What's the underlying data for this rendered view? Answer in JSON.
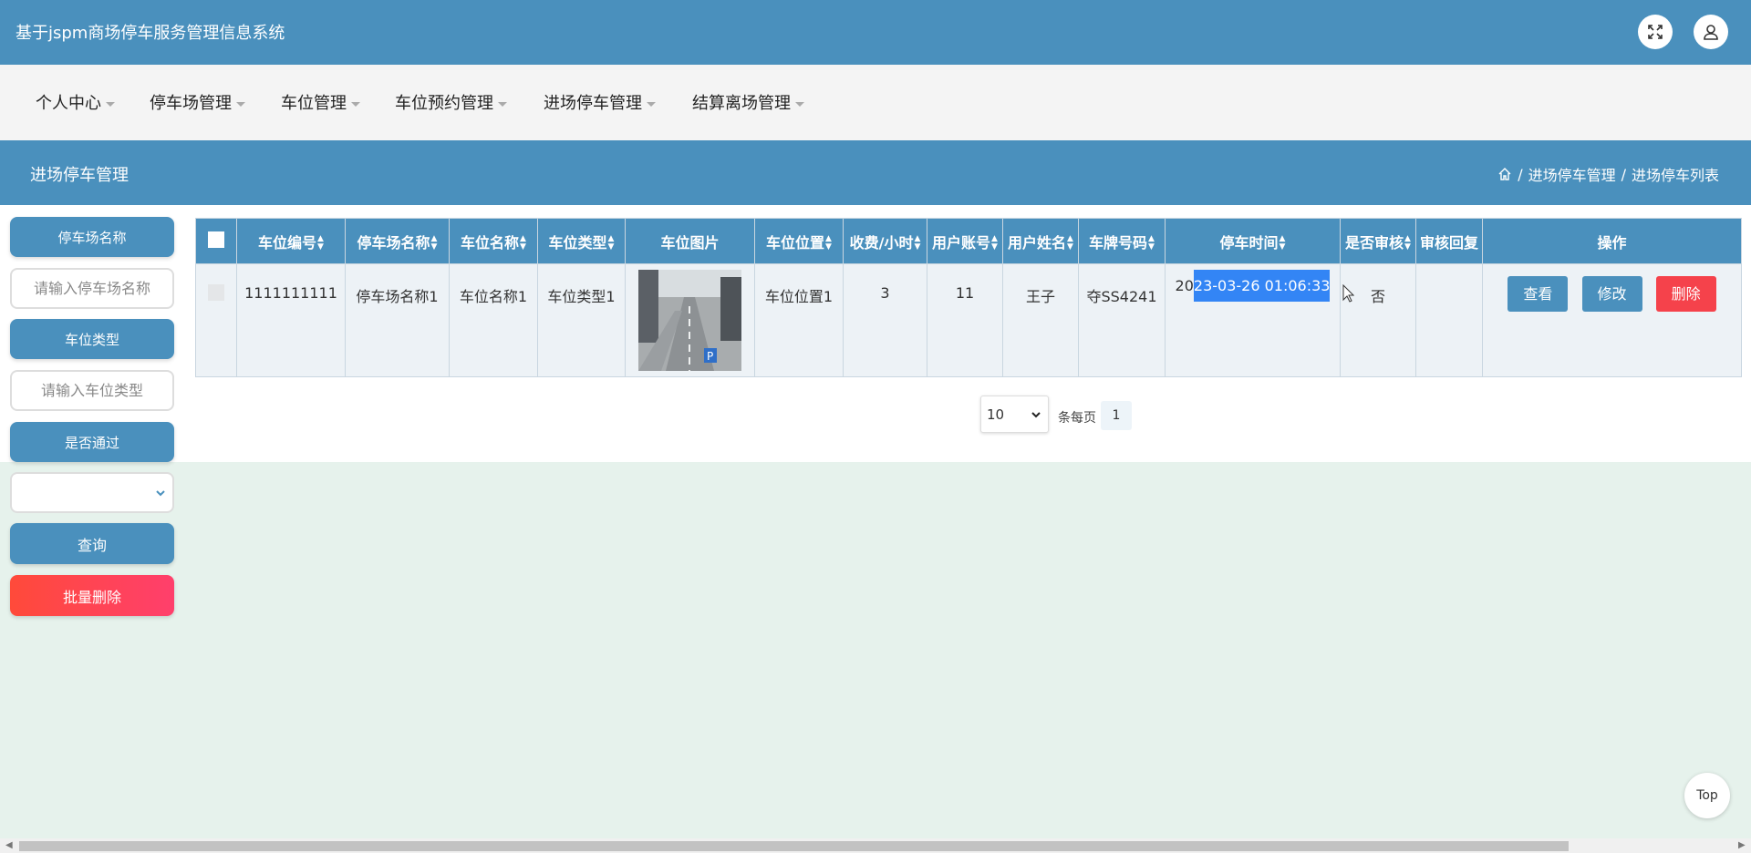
{
  "app": {
    "title": "基于jspm商场停车服务管理信息系统"
  },
  "header_icons": {
    "fullscreen": "expand-icon",
    "user": "user-icon"
  },
  "nav": {
    "items": [
      {
        "label": "个人中心"
      },
      {
        "label": "停车场管理"
      },
      {
        "label": "车位管理"
      },
      {
        "label": "车位预约管理"
      },
      {
        "label": "进场停车管理"
      },
      {
        "label": "结算离场管理"
      }
    ]
  },
  "section": {
    "title": "进场停车管理",
    "breadcrumb": {
      "part1": "进场停车管理",
      "separator": "/",
      "part2": "进场停车列表"
    }
  },
  "sidebar": {
    "parking_name_label": "停车场名称",
    "parking_name_placeholder": "请输入停车场名称",
    "space_type_label": "车位类型",
    "space_type_placeholder": "请输入车位类型",
    "approved_label": "是否通过",
    "approved_value": "",
    "query_button": "查询",
    "batch_delete_button": "批量删除"
  },
  "table": {
    "columns": [
      "车位编号",
      "停车场名称",
      "车位名称",
      "车位类型",
      "车位图片",
      "车位位置",
      "收费/小时",
      "用户账号",
      "用户姓名",
      "车牌号码",
      "停车时间",
      "是否审核",
      "审核回复",
      "操作"
    ],
    "rows": [
      {
        "space_no": "1111111111",
        "parking_name": "停车场名称1",
        "space_name": "车位名称1",
        "space_type": "车位类型1",
        "space_location": "车位位置1",
        "fee_per_hour": "3",
        "user_account": "11",
        "user_name": "王子",
        "plate_no": "夺SS4241",
        "parking_time_prefix": "20",
        "parking_time_selected": "23-03-26 01:06:33",
        "reviewed": "否",
        "review_reply": ""
      }
    ],
    "actions": {
      "view": "查看",
      "edit": "修改",
      "delete": "删除"
    }
  },
  "pagination": {
    "page_size": "10",
    "page_size_options": [
      "10"
    ],
    "per_page_label": "条每页",
    "current_page": "1"
  },
  "back_to_top": "Top",
  "colors": {
    "primary": "#4a90bd",
    "danger": "#f5424b",
    "batch_delete_gradient": [
      "#ff4a3a",
      "#ff3f6c"
    ],
    "selection": "#3385f5",
    "page_bg": "#e6f2ec"
  }
}
